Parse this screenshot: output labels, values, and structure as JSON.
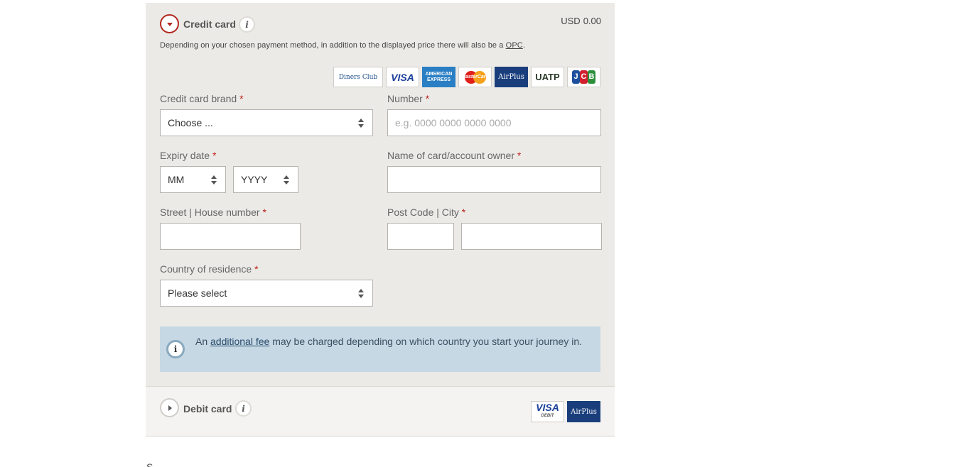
{
  "credit_card": {
    "title": "Credit card",
    "info_icon": "i",
    "currency": "USD",
    "amount": "0.00",
    "note_prefix": "Depending on your chosen payment method, in addition to the displayed price there will also be a",
    "note_link": "OPC",
    "note_suffix": ".",
    "logos": {
      "diners": "Diners Club",
      "visa": "VISA",
      "amex": "AMERICAN EXPRESS",
      "mastercard": "MasterCard",
      "airplus": "AirPlus",
      "uatp": "UATP",
      "jcb_j": "J",
      "jcb_c": "C",
      "jcb_b": "B"
    },
    "brand_label": "Credit card brand",
    "brand_value": "Choose ...",
    "number_label": "Number",
    "number_placeholder": "e.g. 0000 0000 0000 0000",
    "expiry_label": "Expiry date",
    "expiry_month": "MM",
    "expiry_year": "YYYY",
    "owner_label": "Name of card/account owner",
    "street_label": "Street | House number",
    "postcode_label": "Post Code | City",
    "country_label": "Country of residence",
    "country_value": "Please select",
    "required_mark": "*",
    "info_box": {
      "icon": "i",
      "prefix": "An",
      "link": "additional fee",
      "suffix": "may be charged depending on which country you start your journey in."
    }
  },
  "debit_card": {
    "title": "Debit card",
    "info_icon": "i",
    "logos": {
      "visa": "VISA",
      "visa_sub": "DEBIT",
      "airplus": "AirPlus"
    }
  },
  "bottom_fragment": "S"
}
